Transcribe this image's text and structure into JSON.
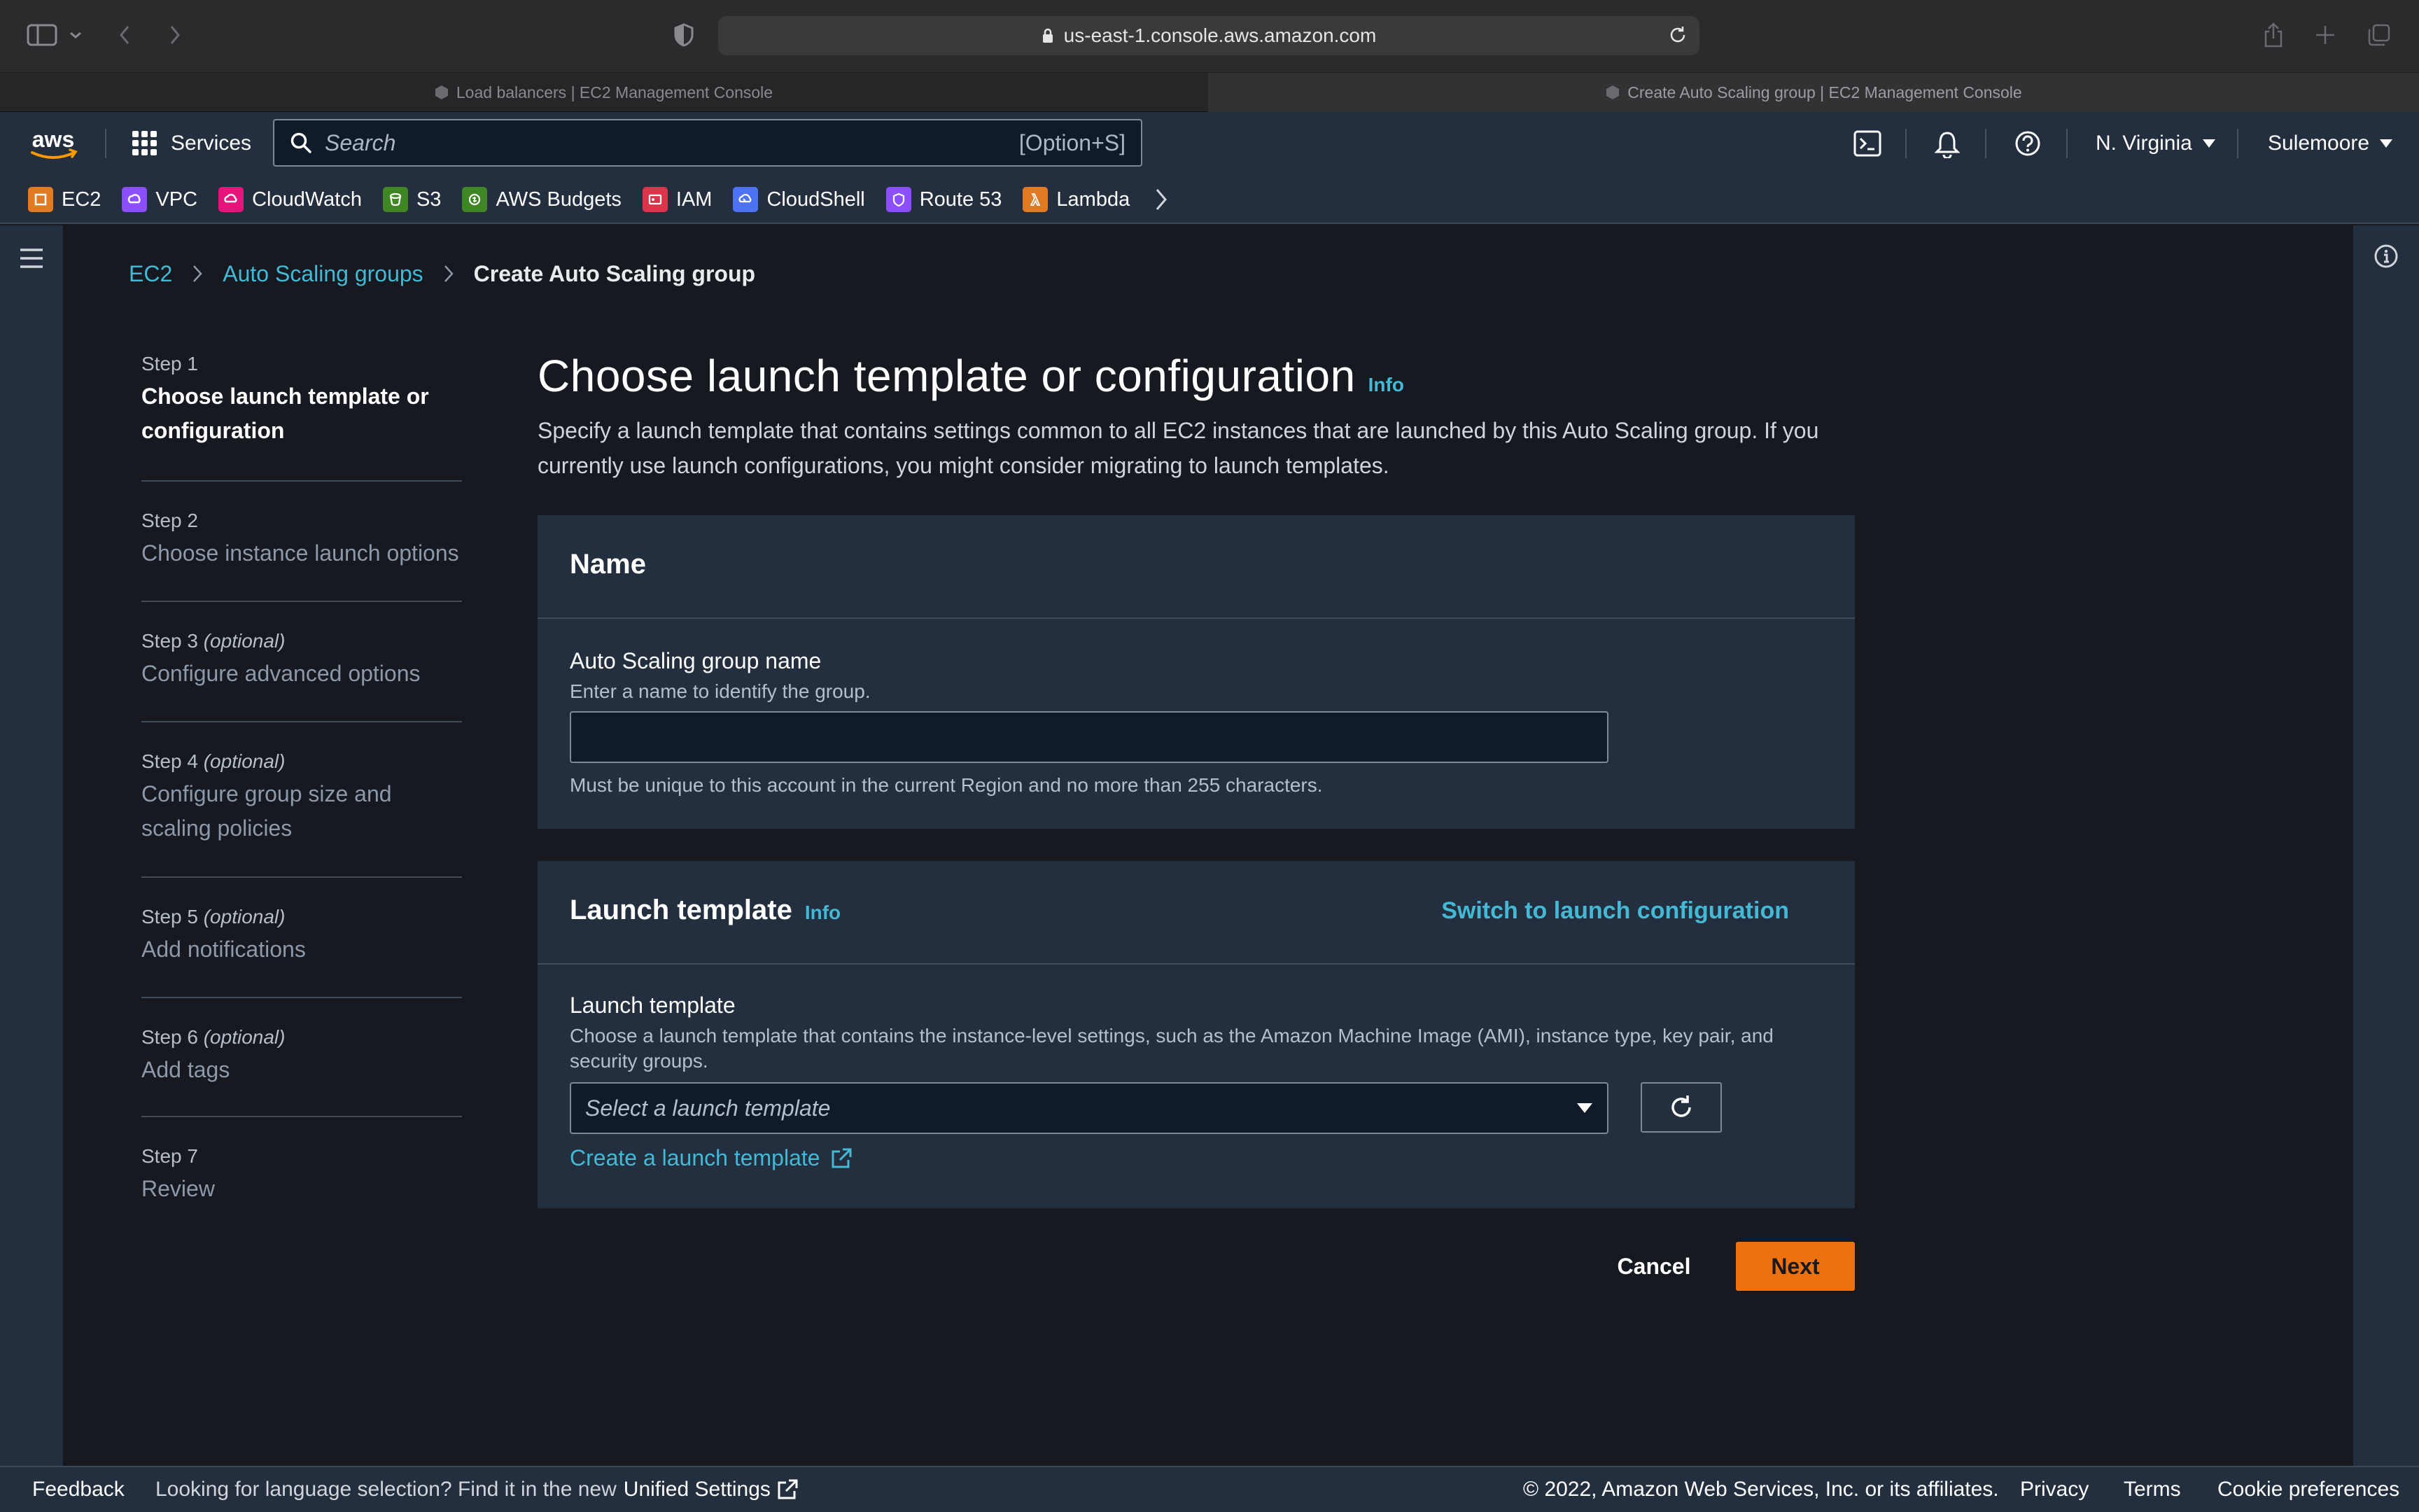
{
  "browser": {
    "url": "us-east-1.console.aws.amazon.com",
    "tabs": [
      {
        "label": "Load balancers | EC2 Management Console",
        "active": false
      },
      {
        "label": "Create Auto Scaling group | EC2 Management Console",
        "active": true
      }
    ]
  },
  "nav": {
    "logo_text": "aws",
    "services_label": "Services",
    "search_placeholder": "Search",
    "search_shortcut": "[Option+S]",
    "region": "N. Virginia",
    "user": "Sulemoore",
    "favorites": [
      {
        "label": "EC2",
        "color": "#e07b23",
        "icon": "ec2-icon"
      },
      {
        "label": "VPC",
        "color": "#8c4fff",
        "icon": "vpc-icon"
      },
      {
        "label": "CloudWatch",
        "color": "#e7157b",
        "icon": "cloudwatch-icon"
      },
      {
        "label": "S3",
        "color": "#3f8624",
        "icon": "s3-icon"
      },
      {
        "label": "AWS Budgets",
        "color": "#3f8624",
        "icon": "budgets-icon"
      },
      {
        "label": "IAM",
        "color": "#dd344c",
        "icon": "iam-icon"
      },
      {
        "label": "CloudShell",
        "color": "#4d72f3",
        "icon": "cloudshell-icon"
      },
      {
        "label": "Route 53",
        "color": "#8c4fff",
        "icon": "route53-icon"
      },
      {
        "label": "Lambda",
        "color": "#e07b23",
        "icon": "lambda-icon"
      }
    ]
  },
  "breadcrumb": {
    "items": [
      "EC2",
      "Auto Scaling groups"
    ],
    "current": "Create Auto Scaling group"
  },
  "steps": [
    {
      "num": "Step 1",
      "optional": "",
      "title": "Choose launch template or configuration",
      "active": true
    },
    {
      "num": "Step 2",
      "optional": "",
      "title": "Choose instance launch options",
      "active": false
    },
    {
      "num": "Step 3",
      "optional": "(optional)",
      "title": "Configure advanced options",
      "active": false
    },
    {
      "num": "Step 4",
      "optional": "(optional)",
      "title": "Configure group size and scaling policies",
      "active": false
    },
    {
      "num": "Step 5",
      "optional": "(optional)",
      "title": "Add notifications",
      "active": false
    },
    {
      "num": "Step 6",
      "optional": "(optional)",
      "title": "Add tags",
      "active": false
    },
    {
      "num": "Step 7",
      "optional": "",
      "title": "Review",
      "active": false
    }
  ],
  "page": {
    "title": "Choose launch template or configuration",
    "info": "Info",
    "description": "Specify a launch template that contains settings common to all EC2 instances that are launched by this Auto Scaling group. If you currently use launch configurations, you might consider migrating to launch templates."
  },
  "name_section": {
    "header": "Name",
    "label": "Auto Scaling group name",
    "description": "Enter a name to identify the group.",
    "value": "",
    "constraint": "Must be unique to this account in the current Region and no more than 255 characters."
  },
  "lt_section": {
    "header": "Launch template",
    "info": "Info",
    "switch_link": "Switch to launch configuration",
    "label": "Launch template",
    "description": "Choose a launch template that contains the instance-level settings, such as the Amazon Machine Image (AMI), instance type, key pair, and security groups.",
    "select_placeholder": "Select a launch template",
    "create_link": "Create a launch template"
  },
  "actions": {
    "cancel": "Cancel",
    "next": "Next"
  },
  "footer": {
    "feedback": "Feedback",
    "lang_text": "Looking for language selection? Find it in the new",
    "lang_link": "Unified Settings",
    "copyright": "© 2022, Amazon Web Services, Inc. or its affiliates.",
    "links": [
      "Privacy",
      "Terms",
      "Cookie preferences"
    ]
  },
  "colors": {
    "accent": "#44b9d6",
    "primary_button": "#ec7211",
    "nav_bg": "#232f3e",
    "page_bg": "#16191f"
  }
}
